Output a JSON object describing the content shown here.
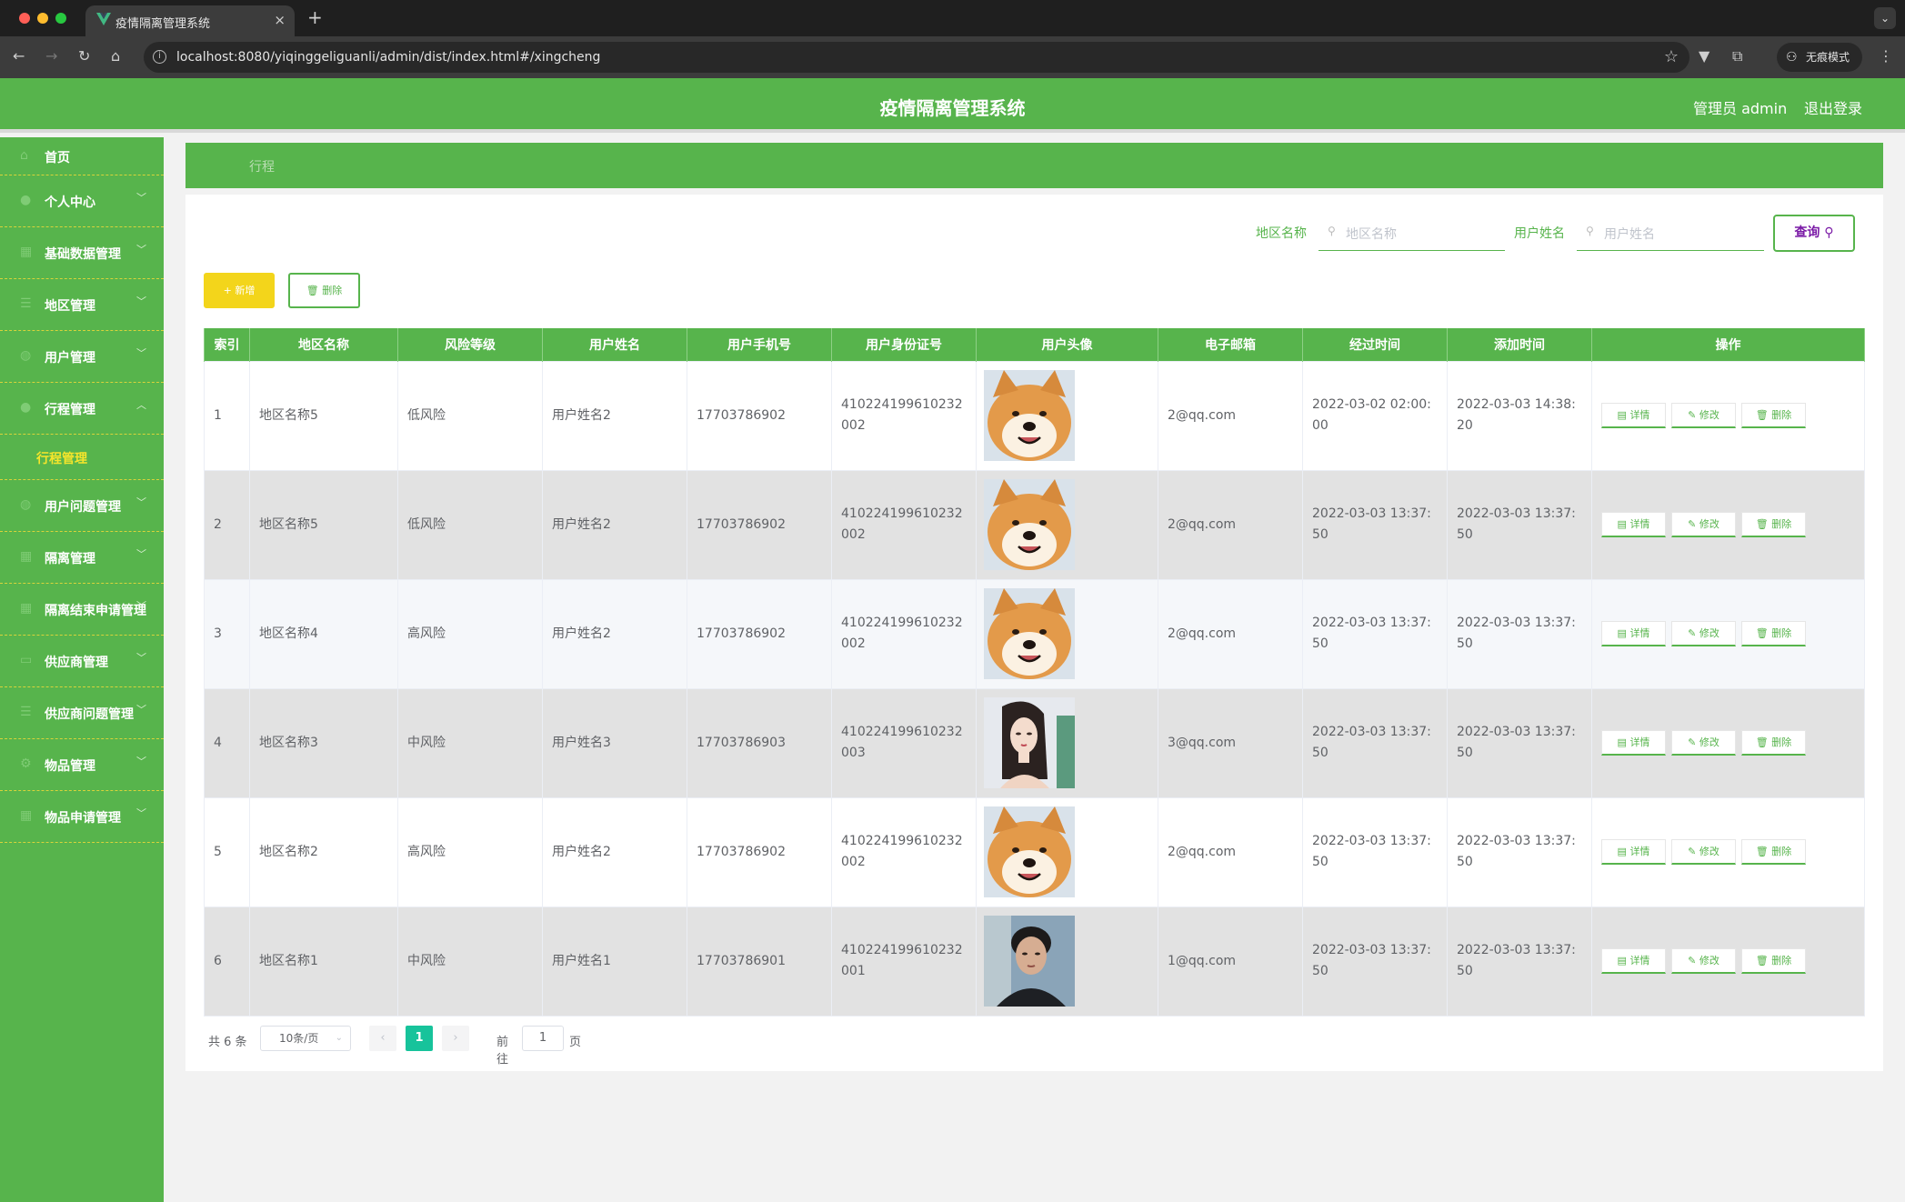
{
  "browser": {
    "tab_title": "疫情隔离管理系统",
    "url": "localhost:8080/yiqinggeliguanli/admin/dist/index.html#/xingcheng",
    "incognito_label": "无痕模式"
  },
  "header": {
    "title": "疫情隔离管理系统",
    "user": "管理员 admin",
    "logout": "退出登录",
    "accent_color": "#57b44c"
  },
  "sidebar": {
    "items": [
      {
        "label": "首页",
        "icon": "home-icon"
      },
      {
        "label": "个人中心",
        "icon": "user-icon"
      },
      {
        "label": "基础数据管理",
        "icon": "grid-icon"
      },
      {
        "label": "地区管理",
        "icon": "list-icon"
      },
      {
        "label": "用户管理",
        "icon": "users-icon"
      },
      {
        "label": "行程管理",
        "icon": "user-icon",
        "expanded": true
      },
      {
        "label": "用户问题管理",
        "icon": "users-icon"
      },
      {
        "label": "隔离管理",
        "icon": "grid-icon"
      },
      {
        "label": "隔离结束申请管理",
        "icon": "grid-icon"
      },
      {
        "label": "供应商管理",
        "icon": "card-icon"
      },
      {
        "label": "供应商问题管理",
        "icon": "list-icon"
      },
      {
        "label": "物品管理",
        "icon": "gear-icon"
      },
      {
        "label": "物品申请管理",
        "icon": "grid-icon"
      }
    ],
    "submenu": {
      "label": "行程管理"
    }
  },
  "breadcrumb": "行程",
  "search": {
    "region_label": "地区名称",
    "region_placeholder": "地区名称",
    "username_label": "用户姓名",
    "username_placeholder": "用户姓名",
    "query_button": "查询"
  },
  "actions": {
    "add": "+ 新增",
    "delete": "删除"
  },
  "table": {
    "headers": [
      "索引",
      "地区名称",
      "风险等级",
      "用户姓名",
      "用户手机号",
      "用户身份证号",
      "用户头像",
      "电子邮箱",
      "经过时间",
      "添加时间",
      "操作"
    ],
    "op_labels": {
      "detail": "详情",
      "edit": "修改",
      "delete": "删除"
    },
    "rows": [
      {
        "index": "1",
        "region": "地区名称5",
        "risk": "低风险",
        "name": "用户姓名2",
        "phone": "17703786902",
        "idcard": "410224199610232002",
        "avatar": "shiba-dog",
        "email": "2@qq.com",
        "pass_time": "2022-03-02 02:00:00",
        "add_time": "2022-03-03 14:38:20"
      },
      {
        "index": "2",
        "region": "地区名称5",
        "risk": "低风险",
        "name": "用户姓名2",
        "phone": "17703786902",
        "idcard": "410224199610232002",
        "avatar": "shiba-dog",
        "email": "2@qq.com",
        "pass_time": "2022-03-03 13:37:50",
        "add_time": "2022-03-03 13:37:50"
      },
      {
        "index": "3",
        "region": "地区名称4",
        "risk": "高风险",
        "name": "用户姓名2",
        "phone": "17703786902",
        "idcard": "410224199610232002",
        "avatar": "shiba-dog",
        "email": "2@qq.com",
        "pass_time": "2022-03-03 13:37:50",
        "add_time": "2022-03-03 13:37:50"
      },
      {
        "index": "4",
        "region": "地区名称3",
        "risk": "中风险",
        "name": "用户姓名3",
        "phone": "17703786903",
        "idcard": "410224199610232003",
        "avatar": "illustrated-woman",
        "email": "3@qq.com",
        "pass_time": "2022-03-03 13:37:50",
        "add_time": "2022-03-03 13:37:50"
      },
      {
        "index": "5",
        "region": "地区名称2",
        "risk": "高风险",
        "name": "用户姓名2",
        "phone": "17703786902",
        "idcard": "410224199610232002",
        "avatar": "shiba-dog",
        "email": "2@qq.com",
        "pass_time": "2022-03-03 13:37:50",
        "add_time": "2022-03-03 13:37:50"
      },
      {
        "index": "6",
        "region": "地区名称1",
        "risk": "中风险",
        "name": "用户姓名1",
        "phone": "17703786901",
        "idcard": "410224199610232001",
        "avatar": "man-photo",
        "email": "1@qq.com",
        "pass_time": "2022-03-03 13:37:50",
        "add_time": "2022-03-03 13:37:50"
      }
    ]
  },
  "pagination": {
    "total": "共 6 条",
    "page_size": "10条/页",
    "current": "1",
    "goto_label": "前往",
    "goto_value": "1",
    "goto_unit": "页"
  }
}
